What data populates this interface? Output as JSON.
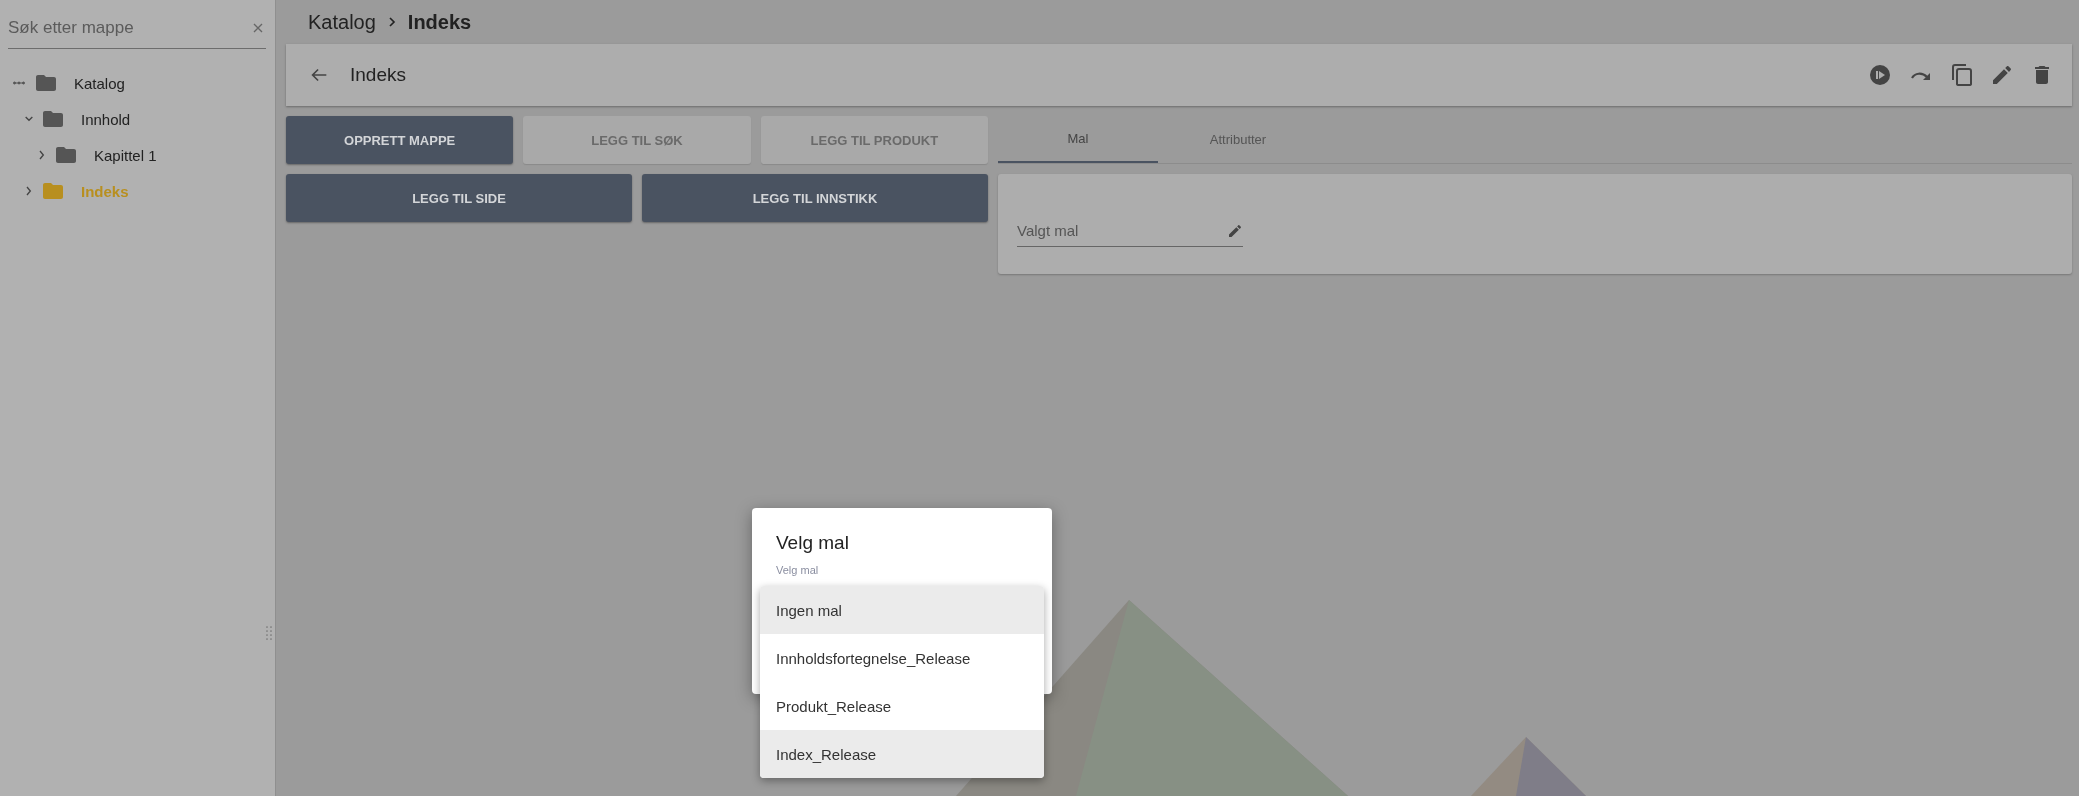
{
  "sidebar": {
    "search": {
      "placeholder": "Søk etter mappe"
    },
    "tree": [
      {
        "label": "Katalog",
        "kind": "root",
        "selected": false,
        "children": [
          {
            "label": "Innhold",
            "kind": "folder",
            "expanded": true,
            "selected": false,
            "children": [
              {
                "label": "Kapittel 1",
                "kind": "folder",
                "expanded": false,
                "selected": false
              }
            ]
          },
          {
            "label": "Indeks",
            "kind": "folder",
            "expanded": false,
            "selected": true
          }
        ]
      }
    ]
  },
  "breadcrumb": [
    "Katalog",
    "Indeks"
  ],
  "header": {
    "title": "Indeks"
  },
  "buttons": [
    [
      {
        "label": "OPPRETT MAPPE",
        "disabled": false
      },
      {
        "label": "LEGG TIL SØK",
        "disabled": true
      },
      {
        "label": "LEGG TIL PRODUKT",
        "disabled": true
      }
    ],
    [
      {
        "label": "LEGG TIL SIDE",
        "disabled": false
      },
      {
        "label": "LEGG TIL INNSTIKK",
        "disabled": false
      }
    ]
  ],
  "tabs": [
    {
      "label": "Mal",
      "selected": true
    },
    {
      "label": "Attributter",
      "selected": false
    }
  ],
  "template_card": {
    "field": {
      "placeholder": "Valgt mal"
    }
  },
  "dialog": {
    "title": "Velg mal",
    "field_label": "Velg mal",
    "options": [
      {
        "label": "Ingen mal",
        "highlighted": true
      },
      {
        "label": "Innholdsfortegnelse_Release",
        "highlighted": false
      },
      {
        "label": "Produkt_Release",
        "highlighted": false
      },
      {
        "label": "Index_Release",
        "highlighted": true
      }
    ]
  }
}
